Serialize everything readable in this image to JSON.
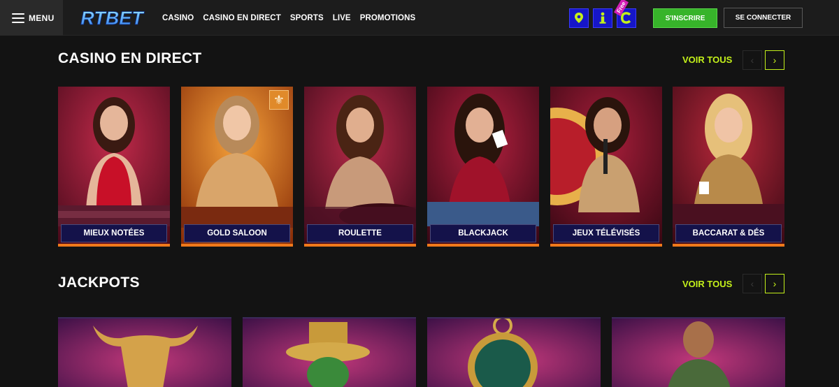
{
  "brand": {
    "logo_text": "RTBET",
    "accent": "#c3f01a",
    "signup_color": "#37b42a",
    "card_border": "#f0791b",
    "label_bg": "#14124a"
  },
  "header": {
    "menu_label": "MENU",
    "nav": [
      "CASINO",
      "CASINO EN DIRECT",
      "SPORTS",
      "LIVE",
      "PROMOTIONS"
    ],
    "utility_icons": [
      "map-pin-icon",
      "info-icon",
      "free-coin-icon"
    ],
    "free_tag": "Free",
    "signup_label": "S'INSCRIRE",
    "login_label": "SE CONNECTER"
  },
  "live_casino": {
    "title": "CASINO EN DIRECT",
    "see_all": "VOIR TOUS",
    "cards": [
      {
        "label": "MIEUX NOTÉES"
      },
      {
        "label": "GOLD SALOON"
      },
      {
        "label": "ROULETTE"
      },
      {
        "label": "BLACKJACK"
      },
      {
        "label": "JEUX TÉLÉVISÉS"
      },
      {
        "label": "BACCARAT & DÉS"
      }
    ]
  },
  "jackpots": {
    "title": "JACKPOTS",
    "see_all": "VOIR TOUS"
  }
}
